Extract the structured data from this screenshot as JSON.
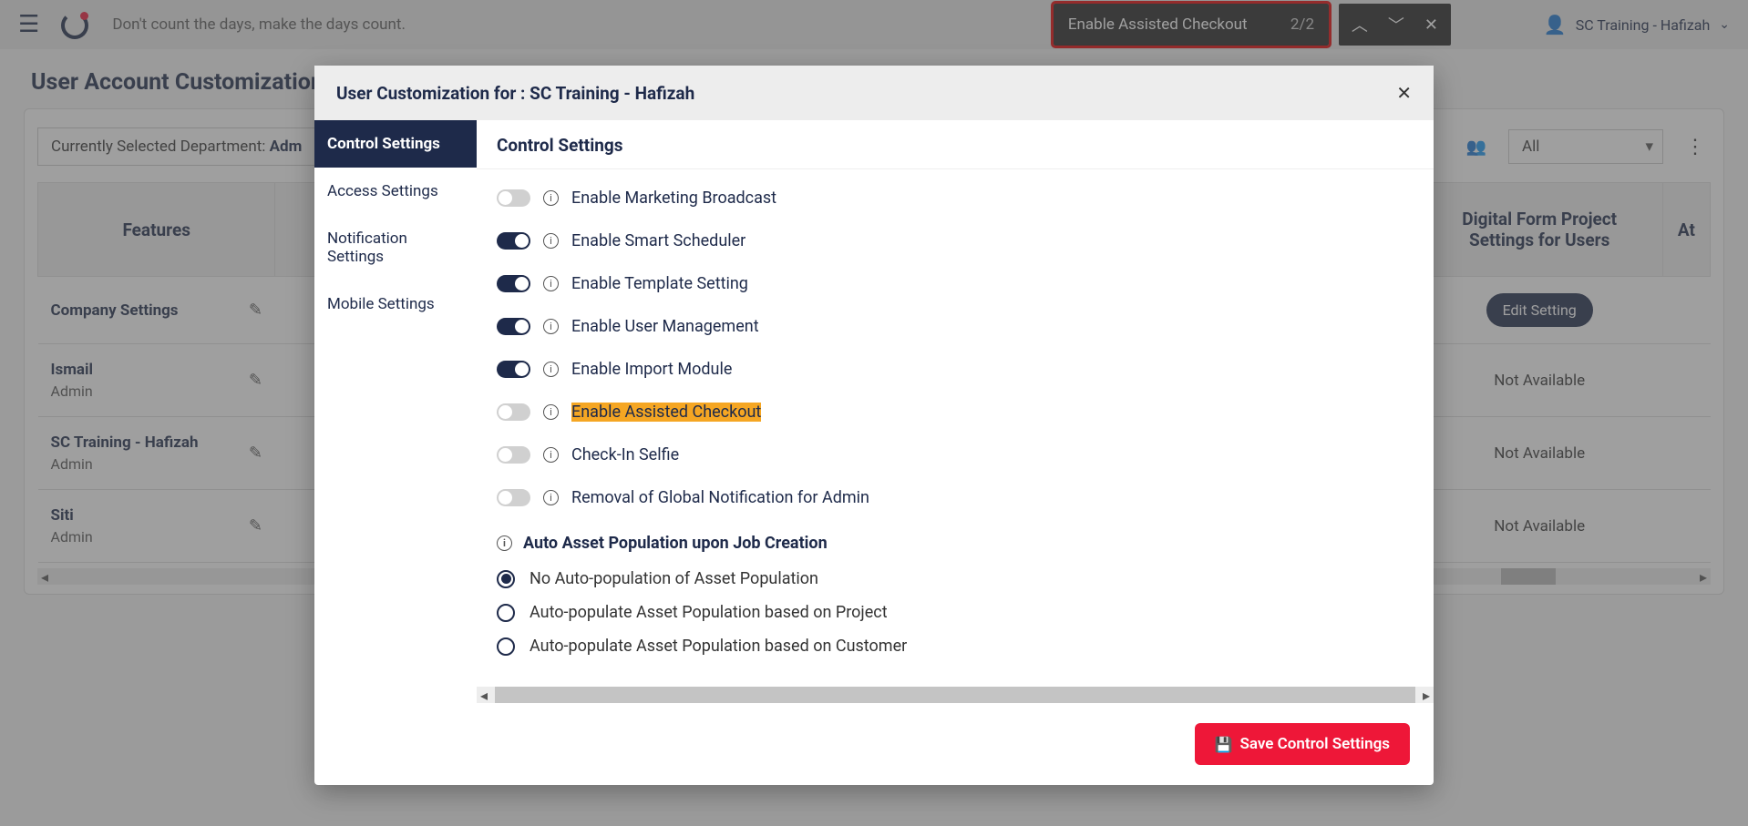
{
  "topbar": {
    "tagline": "Don't count the days, make the days count.",
    "user_label": "SC Training - Hafizah"
  },
  "find": {
    "query": "Enable Assisted Checkout",
    "count": "2/2"
  },
  "page": {
    "title": "User Account Customization",
    "dept_prefix": "Currently Selected Department: ",
    "dept_value": "Adm",
    "filter_all": "All"
  },
  "table": {
    "col_features": "Features",
    "col_digital": "Digital Form Project Settings for Users",
    "col_at": "At",
    "edit_setting": "Edit Setting",
    "not_available": "Not Available",
    "rows": [
      {
        "name": "Company Settings",
        "sub": ""
      },
      {
        "name": "Ismail",
        "sub": "Admin"
      },
      {
        "name": "SC Training - Hafizah",
        "sub": "Admin"
      },
      {
        "name": "Siti",
        "sub": "Admin"
      }
    ]
  },
  "modal": {
    "title": "User Customization for : SC Training - Hafizah",
    "tabs": [
      "Control Settings",
      "Access Settings",
      "Notification Settings",
      "Mobile Settings"
    ],
    "pane_title": "Control Settings",
    "settings": [
      {
        "label": "Enable Marketing Broadcast",
        "on": false
      },
      {
        "label": "Enable Smart Scheduler",
        "on": true
      },
      {
        "label": "Enable Template Setting",
        "on": true
      },
      {
        "label": "Enable User Management",
        "on": true
      },
      {
        "label": "Enable Import Module",
        "on": true
      },
      {
        "label": "Enable Assisted Checkout",
        "on": false,
        "hl": true
      },
      {
        "label": "Check-In Selfie",
        "on": false
      },
      {
        "label": "Removal of Global Notification for Admin",
        "on": false
      }
    ],
    "radio_section": "Auto Asset Population upon Job Creation",
    "radios": [
      {
        "label": "No Auto-population of Asset Population",
        "sel": true
      },
      {
        "label": "Auto-populate Asset Population based on Project",
        "sel": false
      },
      {
        "label": "Auto-populate Asset Population based on Customer",
        "sel": false
      }
    ],
    "save_label": "Save Control Settings"
  }
}
